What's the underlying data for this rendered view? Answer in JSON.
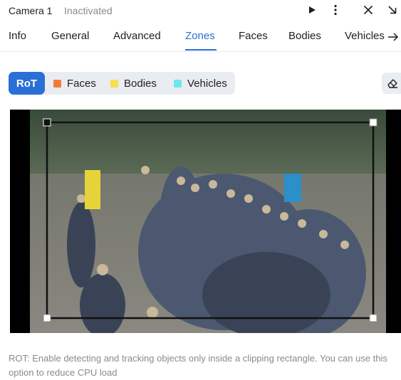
{
  "header": {
    "camera_name": "Camera 1",
    "status": "Inactivated",
    "icons": [
      "play-icon",
      "more-vertical-icon",
      "close-icon",
      "collapse-arrow-icon"
    ]
  },
  "tabs": [
    {
      "label": "Info",
      "active": false
    },
    {
      "label": "General",
      "active": false
    },
    {
      "label": "Advanced",
      "active": false
    },
    {
      "label": "Zones",
      "active": true
    },
    {
      "label": "Faces",
      "active": false
    },
    {
      "label": "Bodies",
      "active": false
    },
    {
      "label": "Vehicles",
      "active": false
    }
  ],
  "zone_selector": {
    "items": [
      {
        "label": "RoT",
        "active": true
      },
      {
        "label": "Faces",
        "color": "#f07c3a"
      },
      {
        "label": "Bodies",
        "color": "#f5df4d"
      },
      {
        "label": "Vehicles",
        "color": "#6fe6e8"
      }
    ],
    "eraser_icon": "eraser-icon"
  },
  "preview": {
    "description_icon": "camera-preview-image"
  },
  "hint": "ROT: Enable detecting and tracking objects only inside a clipping rectangle. You can use this option to reduce CPU load",
  "colors": {
    "accent": "#2a6fd6",
    "segment_bg": "#e9ecf1",
    "muted_text": "#8a8a8a"
  }
}
